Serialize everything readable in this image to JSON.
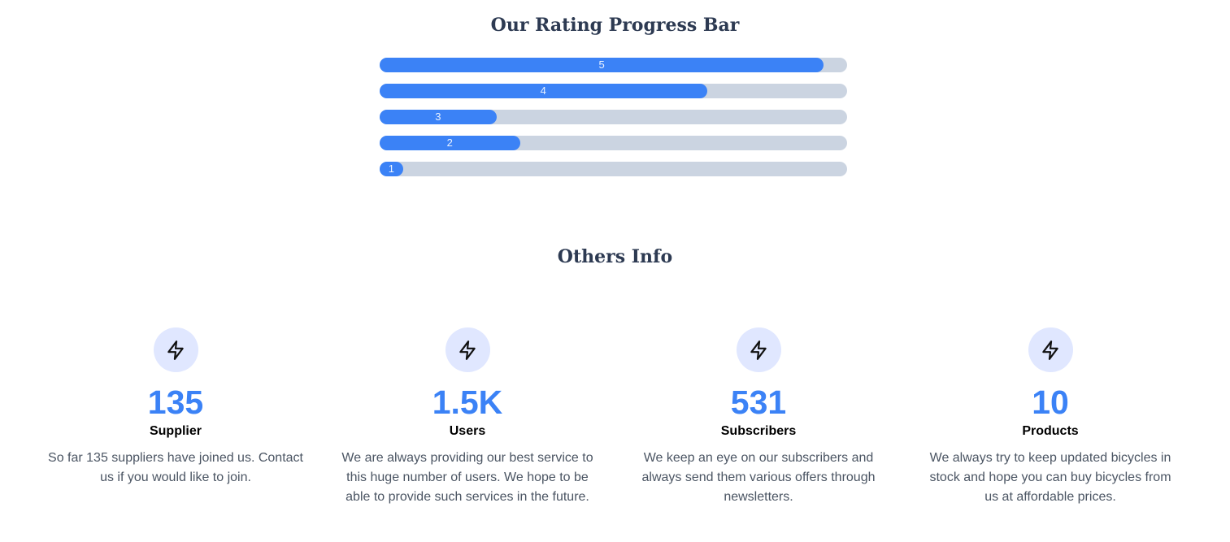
{
  "rating": {
    "title": "Our Rating Progress Bar",
    "bars": [
      {
        "label": "5",
        "percent": 95
      },
      {
        "label": "4",
        "percent": 70
      },
      {
        "label": "3",
        "percent": 25
      },
      {
        "label": "2",
        "percent": 30
      },
      {
        "label": "1",
        "percent": 5
      }
    ]
  },
  "others": {
    "title": "Others Info",
    "items": [
      {
        "icon": "lightning-bolt-icon",
        "number": "135",
        "label": "Supplier",
        "description": "So far 135 suppliers have joined us. Contact us if you would like to join."
      },
      {
        "icon": "lightning-bolt-icon",
        "number": "1.5K",
        "label": "Users",
        "description": "We are always providing our best service to this huge number of users. We hope to be able to provide such services in the future."
      },
      {
        "icon": "lightning-bolt-icon",
        "number": "531",
        "label": "Subscribers",
        "description": "We keep an eye on our subscribers and always send them various offers through newsletters."
      },
      {
        "icon": "lightning-bolt-icon",
        "number": "10",
        "label": "Products",
        "description": "We always try to keep updated bicycles in stock and hope you can buy bicycles from us at affordable prices."
      }
    ]
  },
  "colors": {
    "accent": "#3b82f6",
    "track": "#cbd4e1",
    "icon_bg": "#e0e7ff",
    "heading": "#2d3a52"
  }
}
